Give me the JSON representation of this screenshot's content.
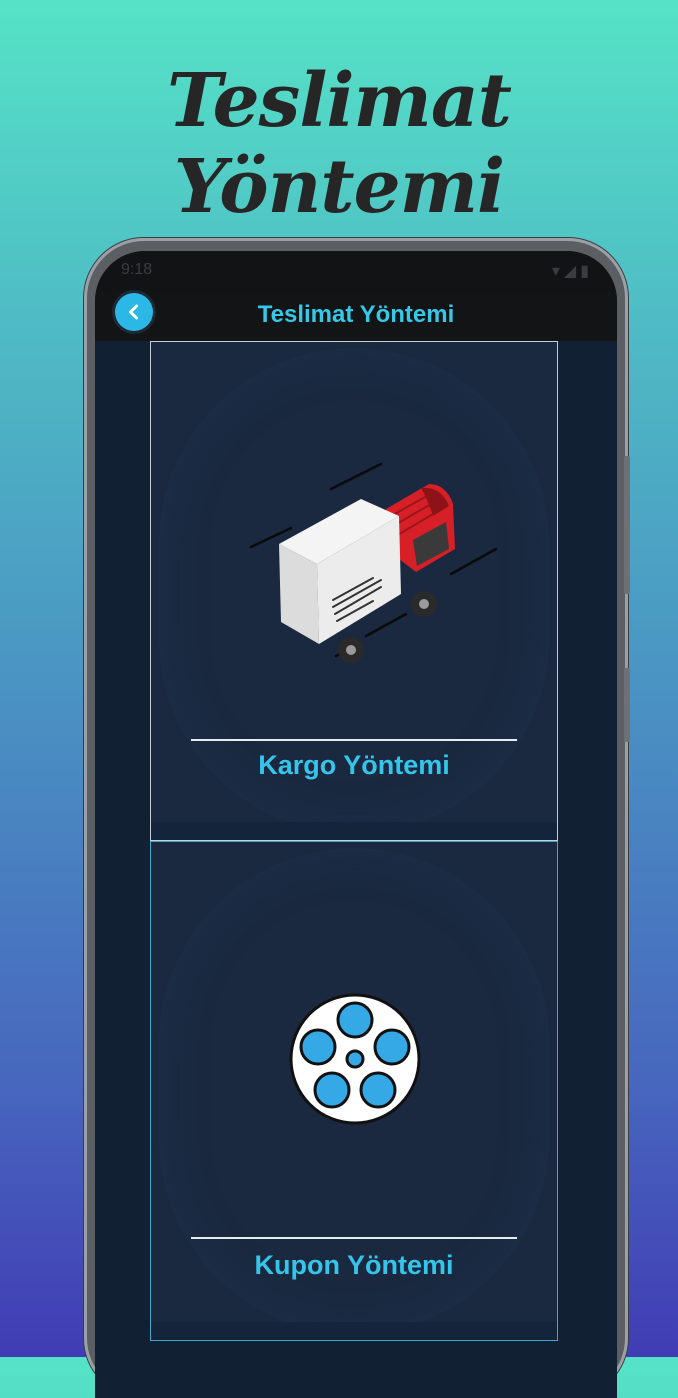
{
  "promo": {
    "title": "Teslimat Yöntemi"
  },
  "statusbar": {
    "time": "9:18"
  },
  "appbar": {
    "title": "Teslimat Yöntemi"
  },
  "options": [
    {
      "label": "Kargo Yöntemi",
      "icon": "delivery-truck-icon"
    },
    {
      "label": "Kupon Yöntemi",
      "icon": "film-reel-icon"
    }
  ],
  "colors": {
    "accent": "#35c5ea",
    "card_bg": "#1a2940",
    "screen_bg": "#112033"
  }
}
